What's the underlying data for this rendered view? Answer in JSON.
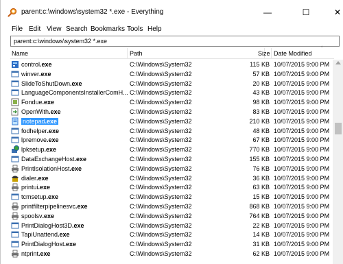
{
  "window": {
    "title": "parent:c:\\windows\\system32 *.exe - Everything",
    "minimize_glyph": "—",
    "maximize_glyph": "☐",
    "close_glyph": "✕"
  },
  "menu": [
    "File",
    "Edit",
    "View",
    "Search",
    "Bookmarks",
    "Tools",
    "Help"
  ],
  "search": {
    "value": "parent:c:\\windows\\system32 *.exe"
  },
  "columns": {
    "name": "Name",
    "path": "Path",
    "size": "Size",
    "date": "Date Modified"
  },
  "rows": [
    {
      "name": "control.exe",
      "path": "C:\\Windows\\System32",
      "size": "115 KB",
      "date": "10/07/2015 9:00 PM",
      "icon": "control-panel-icon"
    },
    {
      "name": "winver.exe",
      "path": "C:\\Windows\\System32",
      "size": "57 KB",
      "date": "10/07/2015 9:00 PM",
      "icon": "window-app-icon"
    },
    {
      "name": "SlideToShutDown.exe",
      "path": "C:\\Windows\\System32",
      "size": "20 KB",
      "date": "10/07/2015 9:00 PM",
      "icon": "window-app-icon"
    },
    {
      "name": "LanguageComponentsInstallerComH...",
      "path": "C:\\Windows\\System32",
      "size": "43 KB",
      "date": "10/07/2015 9:00 PM",
      "icon": "window-app-icon"
    },
    {
      "name": "Fondue.exe",
      "path": "C:\\Windows\\System32",
      "size": "98 KB",
      "date": "10/07/2015 9:00 PM",
      "icon": "package-icon"
    },
    {
      "name": "OpenWith.exe",
      "path": "C:\\Windows\\System32",
      "size": "83 KB",
      "date": "10/07/2015 9:00 PM",
      "icon": "open-with-icon"
    },
    {
      "name": "notepad.exe",
      "path": "C:\\Windows\\System32",
      "size": "210 KB",
      "date": "10/07/2015 9:00 PM",
      "icon": "notepad-icon",
      "selected": true
    },
    {
      "name": "fodhelper.exe",
      "path": "C:\\Windows\\System32",
      "size": "48 KB",
      "date": "10/07/2015 9:00 PM",
      "icon": "window-app-icon"
    },
    {
      "name": "lpremove.exe",
      "path": "C:\\Windows\\System32",
      "size": "67 KB",
      "date": "10/07/2015 9:00 PM",
      "icon": "window-app-icon"
    },
    {
      "name": "lpksetup.exe",
      "path": "C:\\Windows\\System32",
      "size": "770 KB",
      "date": "10/07/2015 9:00 PM",
      "icon": "globe-setup-icon"
    },
    {
      "name": "DataExchangeHost.exe",
      "path": "C:\\Windows\\System32",
      "size": "155 KB",
      "date": "10/07/2015 9:00 PM",
      "icon": "window-app-icon"
    },
    {
      "name": "PrintIsolationHost.exe",
      "path": "C:\\Windows\\System32",
      "size": "76 KB",
      "date": "10/07/2015 9:00 PM",
      "icon": "printer-icon"
    },
    {
      "name": "dialer.exe",
      "path": "C:\\Windows\\System32",
      "size": "36 KB",
      "date": "10/07/2015 9:00 PM",
      "icon": "phone-icon"
    },
    {
      "name": "printui.exe",
      "path": "C:\\Windows\\System32",
      "size": "63 KB",
      "date": "10/07/2015 9:00 PM",
      "icon": "printer-icon"
    },
    {
      "name": "tcmsetup.exe",
      "path": "C:\\Windows\\System32",
      "size": "15 KB",
      "date": "10/07/2015 9:00 PM",
      "icon": "window-app-icon"
    },
    {
      "name": "printfilterpipelinesvc.exe",
      "path": "C:\\Windows\\System32",
      "size": "868 KB",
      "date": "10/07/2015 9:00 PM",
      "icon": "printer-icon"
    },
    {
      "name": "spoolsv.exe",
      "path": "C:\\Windows\\System32",
      "size": "764 KB",
      "date": "10/07/2015 9:00 PM",
      "icon": "printer-icon"
    },
    {
      "name": "PrintDialogHost3D.exe",
      "path": "C:\\Windows\\System32",
      "size": "22 KB",
      "date": "10/07/2015 9:00 PM",
      "icon": "window-app-icon"
    },
    {
      "name": "TapiUnattend.exe",
      "path": "C:\\Windows\\System32",
      "size": "14 KB",
      "date": "10/07/2015 9:00 PM",
      "icon": "window-app-icon"
    },
    {
      "name": "PrintDialogHost.exe",
      "path": "C:\\Windows\\System32",
      "size": "31 KB",
      "date": "10/07/2015 9:00 PM",
      "icon": "window-app-icon"
    },
    {
      "name": "ntprint.exe",
      "path": "C:\\Windows\\System32",
      "size": "62 KB",
      "date": "10/07/2015 9:00 PM",
      "icon": "printer-icon"
    }
  ],
  "colors": {
    "selection": "#3399ff",
    "accent": "#e07020"
  }
}
